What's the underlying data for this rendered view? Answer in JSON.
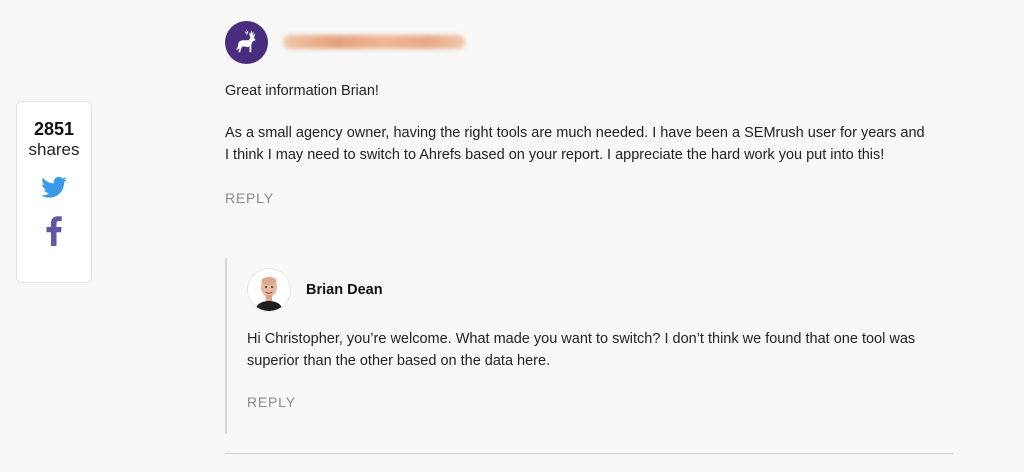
{
  "share": {
    "count": "2851",
    "label": "shares",
    "icons": [
      "twitter-icon",
      "facebook-icon"
    ],
    "twitter_color": "#3b9be8",
    "facebook_color": "#5e56a8"
  },
  "comment": {
    "avatar_color": "#4a2d7e",
    "avatar_icon": "deer-icon",
    "greeting": "Great information Brian!",
    "body": "As a small agency owner, having the right tools are much needed. I have been a SEMrush user for years and I think I may need to switch to Ahrefs based on your report. I appreciate the hard work you put into this!",
    "reply_label": "REPLY"
  },
  "reply": {
    "author": "Brian Dean",
    "body": "Hi Christopher, you’re welcome. What made you want to switch? I don’t think we found that one tool was superior than the other based on the data here.",
    "reply_label": "REPLY"
  }
}
